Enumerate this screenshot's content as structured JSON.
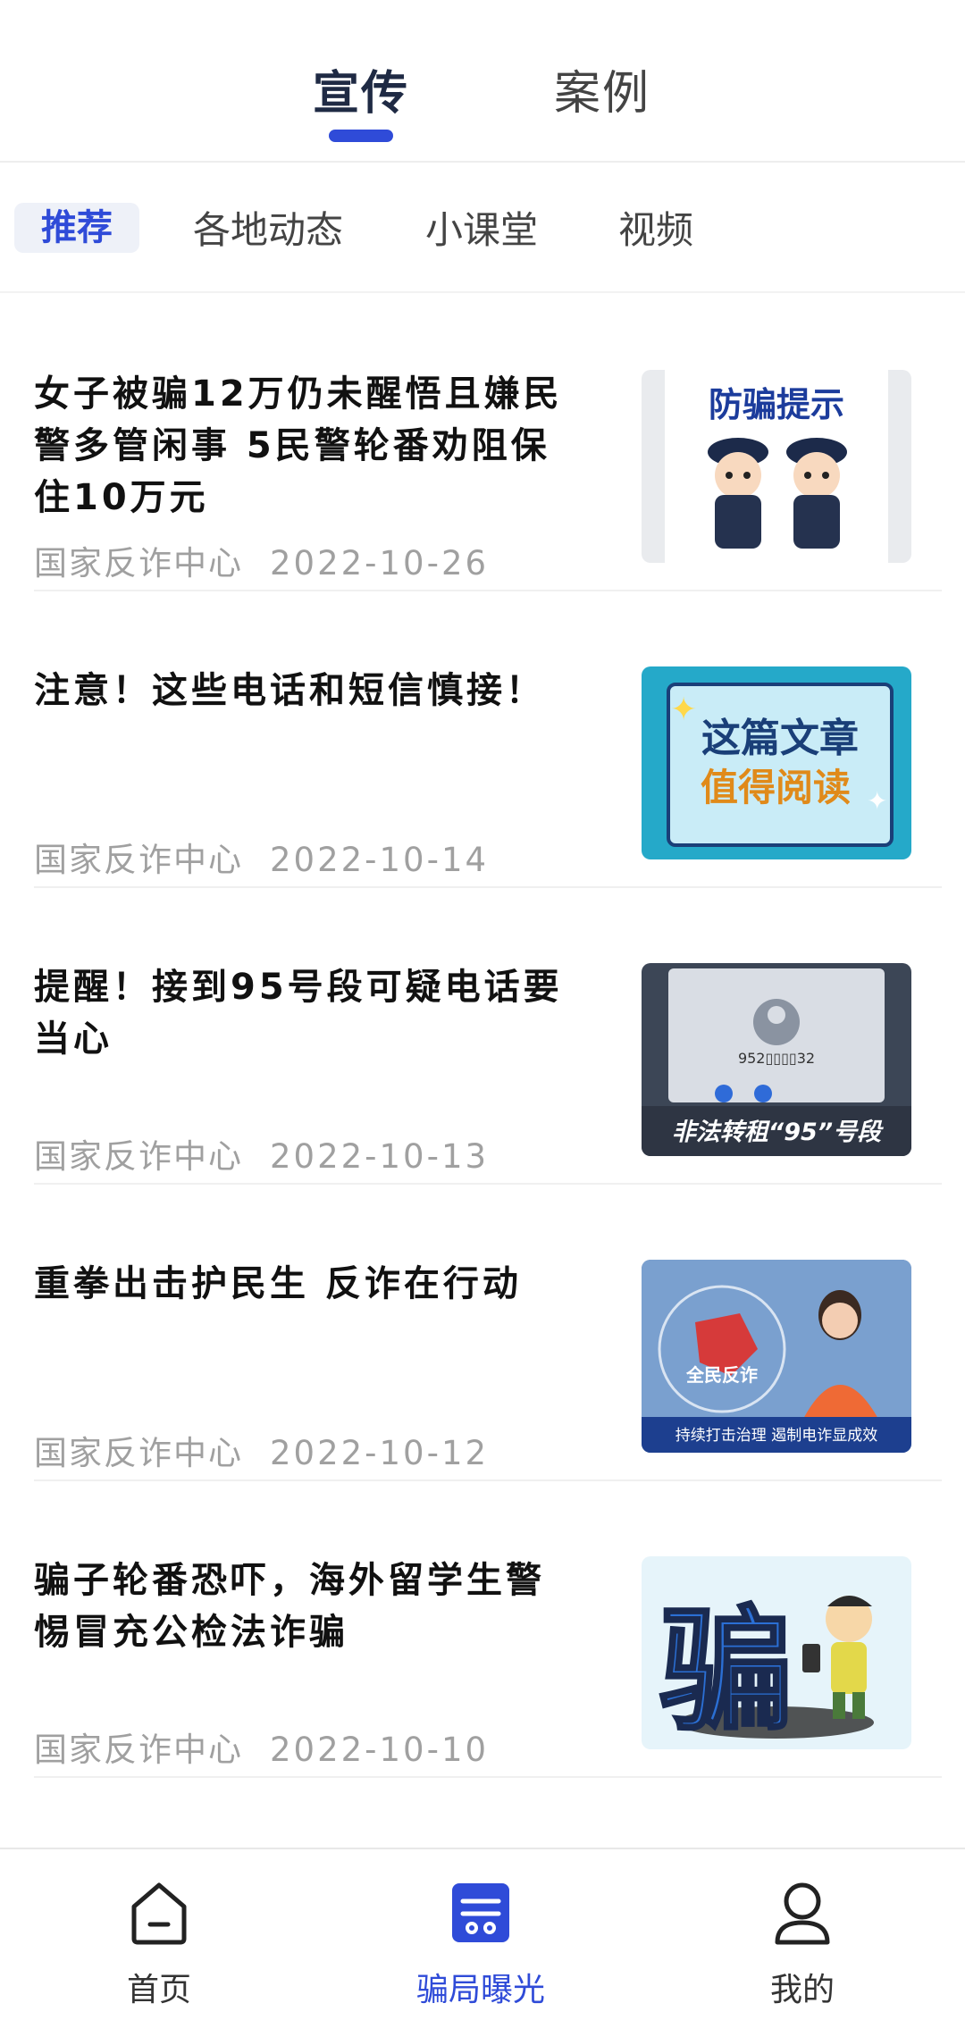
{
  "top_tabs": [
    {
      "label": "宣传",
      "active": true
    },
    {
      "label": "案例",
      "active": false
    }
  ],
  "sub_tabs": [
    {
      "label": "推荐",
      "active": true
    },
    {
      "label": "各地动态",
      "active": false
    },
    {
      "label": "小课堂",
      "active": false
    },
    {
      "label": "视频",
      "active": false
    }
  ],
  "articles": [
    {
      "title": "女子被骗12万仍未醒悟且嫌民警多管闲事 5民警轮番劝阻保住10万元",
      "source": "国家反诈中心",
      "date": "2022-10-26",
      "thumb_text": "防骗提示"
    },
    {
      "title": "注意！这些电话和短信慎接！",
      "source": "国家反诈中心",
      "date": "2022-10-14",
      "thumb_text_1": "这篇文章",
      "thumb_text_2": "值得阅读"
    },
    {
      "title": "提醒！接到95号段可疑电话要当心",
      "source": "国家反诈中心",
      "date": "2022-10-13",
      "thumb_text": "非法转租“95”号段",
      "thumb_number": "952▯▯▯▯32"
    },
    {
      "title": "重拳出击护民生 反诈在行动",
      "source": "国家反诈中心",
      "date": "2022-10-12",
      "thumb_text": "全民反诈",
      "thumb_caption": "持续打击治理 遏制电诈显成效"
    },
    {
      "title": "骗子轮番恐吓，海外留学生警惕冒充公检法诈骗",
      "source": "国家反诈中心",
      "date": "2022-10-10",
      "thumb_text": "骗"
    }
  ],
  "bottom_nav": [
    {
      "label": "首页",
      "icon": "home-icon",
      "active": false
    },
    {
      "label": "骗局曝光",
      "icon": "expose-icon",
      "active": true
    },
    {
      "label": "我的",
      "icon": "user-icon",
      "active": false
    }
  ],
  "colors": {
    "accent": "#2f4bd8",
    "meta_text": "#a0a0a0"
  }
}
